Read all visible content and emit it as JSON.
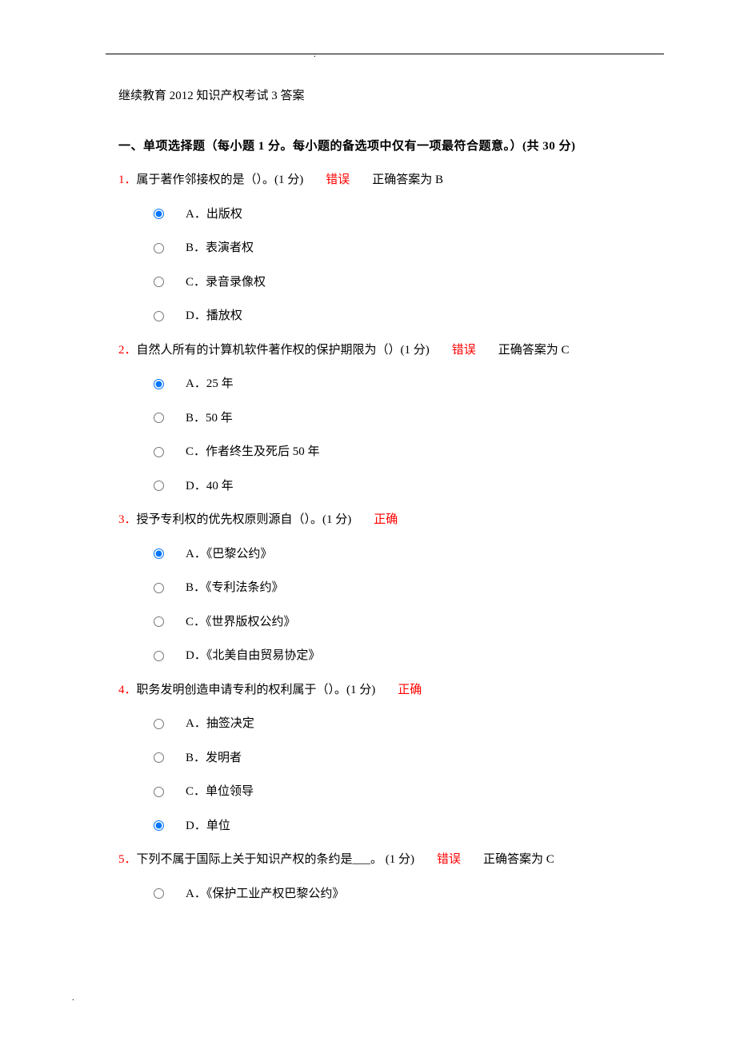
{
  "doc_title": "继续教育 2012 知识产权考试 3 答案",
  "section_header": "一、单项选择题（每小题 1 分。每小题的备选项中仅有一项最符合题意。）(共 30 分)",
  "labels": {
    "wrong": "错误",
    "correct": "正确",
    "answer_prefix": "正确答案为 "
  },
  "questions": [
    {
      "num": "1．",
      "text": "属于著作邻接权的是（）。(1 分)",
      "status": "wrong",
      "correct_answer": "B",
      "selected": "A",
      "options": [
        "A．出版权",
        "B．表演者权",
        "C．录音录像权",
        "D．播放权"
      ]
    },
    {
      "num": "2．",
      "text": "自然人所有的计算机软件著作权的保护期限为（）(1 分)",
      "status": "wrong",
      "correct_answer": "C",
      "selected": "A",
      "options": [
        "A．25 年",
        "B．50 年",
        "C．作者终生及死后 50 年",
        "D．40 年"
      ]
    },
    {
      "num": "3．",
      "text": "授予专利权的优先权原则源自（）。(1 分)",
      "status": "correct",
      "correct_answer": null,
      "selected": "A",
      "options": [
        "A．《巴黎公约》",
        "B．《专利法条约》",
        "C．《世界版权公约》",
        "D．《北美自由贸易协定》"
      ]
    },
    {
      "num": "4．",
      "text": "职务发明创造申请专利的权利属于（）。(1 分)",
      "status": "correct",
      "correct_answer": null,
      "selected": "D",
      "options": [
        "A．抽签决定",
        "B．发明者",
        "C．单位领导",
        "D．单位"
      ]
    },
    {
      "num": "5．",
      "text": "下列不属于国际上关于知识产权的条约是___。 (1 分)",
      "status": "wrong",
      "correct_answer": "C",
      "selected": null,
      "options": [
        "A．《保护工业产权巴黎公约》"
      ]
    }
  ]
}
